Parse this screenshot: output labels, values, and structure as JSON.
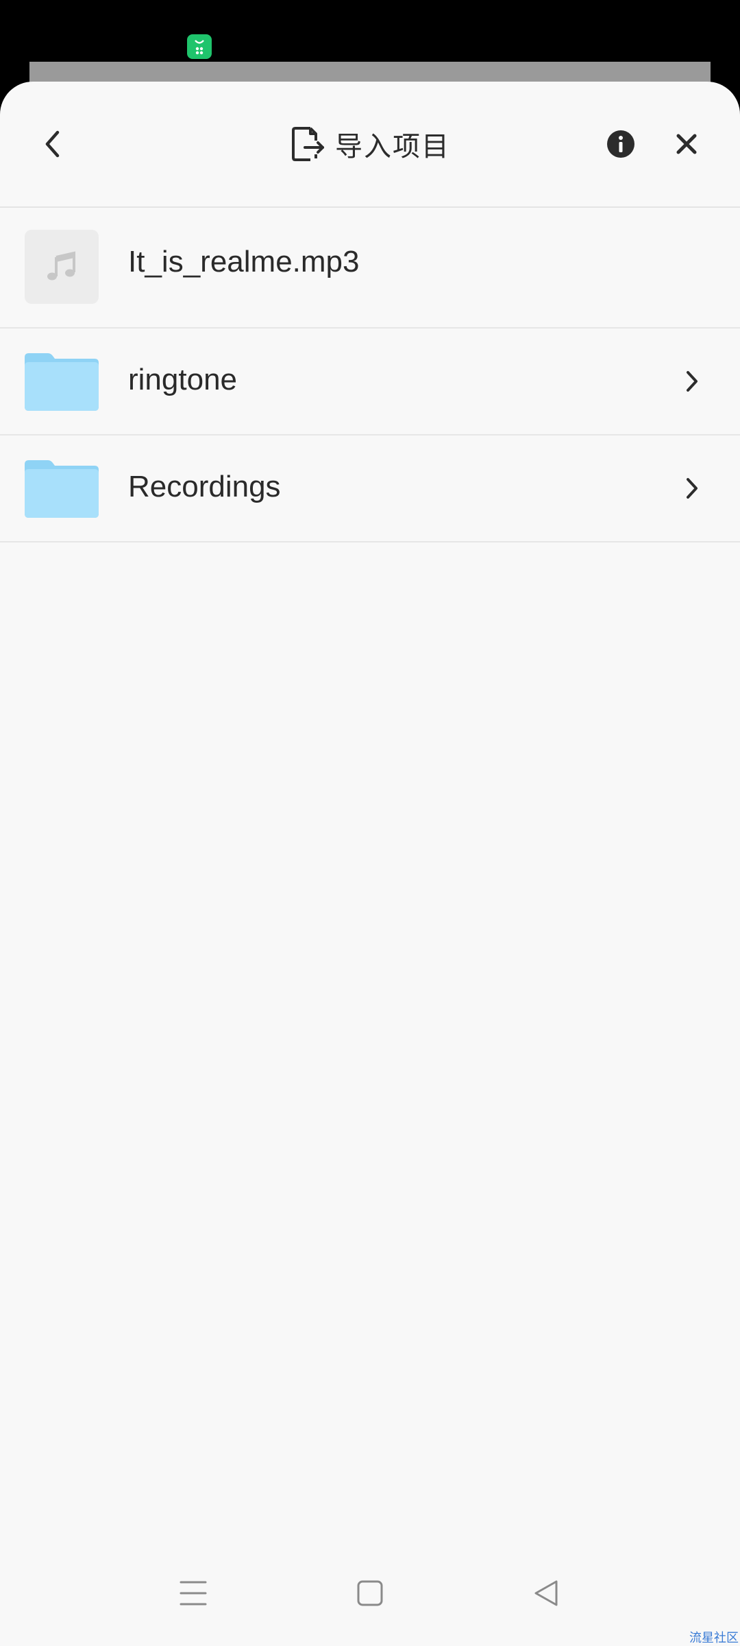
{
  "status_bar": {
    "notification_icon": "green-app-notification-icon"
  },
  "header": {
    "title": "导入项目",
    "back_icon": "chevron-left-icon",
    "title_icon": "import-file-icon",
    "info_icon": "info-icon",
    "close_icon": "close-icon"
  },
  "items": [
    {
      "type": "file",
      "name": "It_is_realme.mp3",
      "icon": "music-note-icon"
    },
    {
      "type": "folder",
      "name": "ringtone",
      "icon": "folder-icon"
    },
    {
      "type": "folder",
      "name": "Recordings",
      "icon": "folder-icon"
    }
  ],
  "nav_bar": {
    "menu_icon": "menu-lines-icon",
    "home_icon": "square-home-icon",
    "back_icon": "triangle-back-icon"
  },
  "watermark": "流星社区",
  "colors": {
    "sheet_background": "#f8f8f8",
    "folder_blue": "#9ddcf9",
    "accent_green": "#1fc46c",
    "text_primary": "#2a2a2a"
  }
}
